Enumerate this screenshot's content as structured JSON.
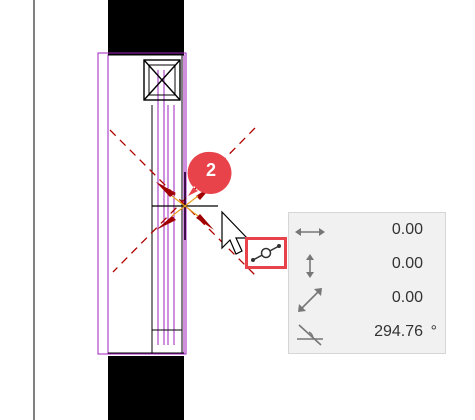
{
  "step_badge": {
    "number": "2",
    "color": "#e8434b"
  },
  "snap_indicator": {
    "icon": "endpoint-snap-icon",
    "highlight_color": "#e8434b"
  },
  "tracker": {
    "rows": [
      {
        "icon": "horizontal-arrow-icon",
        "value": "0.00",
        "unit": ""
      },
      {
        "icon": "vertical-arrow-icon",
        "value": "0.00",
        "unit": ""
      },
      {
        "icon": "diagonal-arrow-icon",
        "value": "0.00",
        "unit": ""
      },
      {
        "icon": "angle-icon",
        "value": "294.76",
        "unit": "°"
      }
    ]
  },
  "colors": {
    "wall_fill": "#000000",
    "window_lines": "#a020c0",
    "guide_lines": "#b00000",
    "cursor_marker": "#a00000"
  }
}
